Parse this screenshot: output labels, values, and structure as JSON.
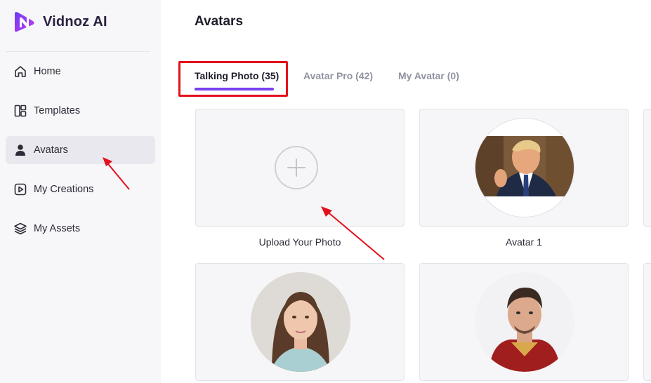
{
  "app": {
    "brand_name": "Vidnoz AI"
  },
  "sidebar": {
    "items": [
      {
        "label": "Home",
        "icon": "home-icon"
      },
      {
        "label": "Templates",
        "icon": "templates-icon"
      },
      {
        "label": "Avatars",
        "icon": "avatar-person-icon",
        "active": true
      },
      {
        "label": "My Creations",
        "icon": "play-icon"
      },
      {
        "label": "My Assets",
        "icon": "layers-icon"
      }
    ]
  },
  "main": {
    "title": "Avatars",
    "tabs": [
      {
        "label": "Talking Photo (35)",
        "active": true
      },
      {
        "label": "Avatar Pro (42)"
      },
      {
        "label": "My Avatar (0)"
      }
    ],
    "cards": [
      {
        "caption": "Upload Your Photo",
        "type": "upload",
        "icon": "plus-icon"
      },
      {
        "caption": "Avatar 1",
        "type": "avatar"
      },
      {
        "caption": "",
        "type": "avatar"
      },
      {
        "caption": "",
        "type": "avatar"
      }
    ]
  },
  "colors": {
    "accent": "#7a3ff2",
    "highlight": "#e4101b",
    "sidebar_bg": "#f7f7f9",
    "active_nav_bg": "#e8e8ee"
  }
}
